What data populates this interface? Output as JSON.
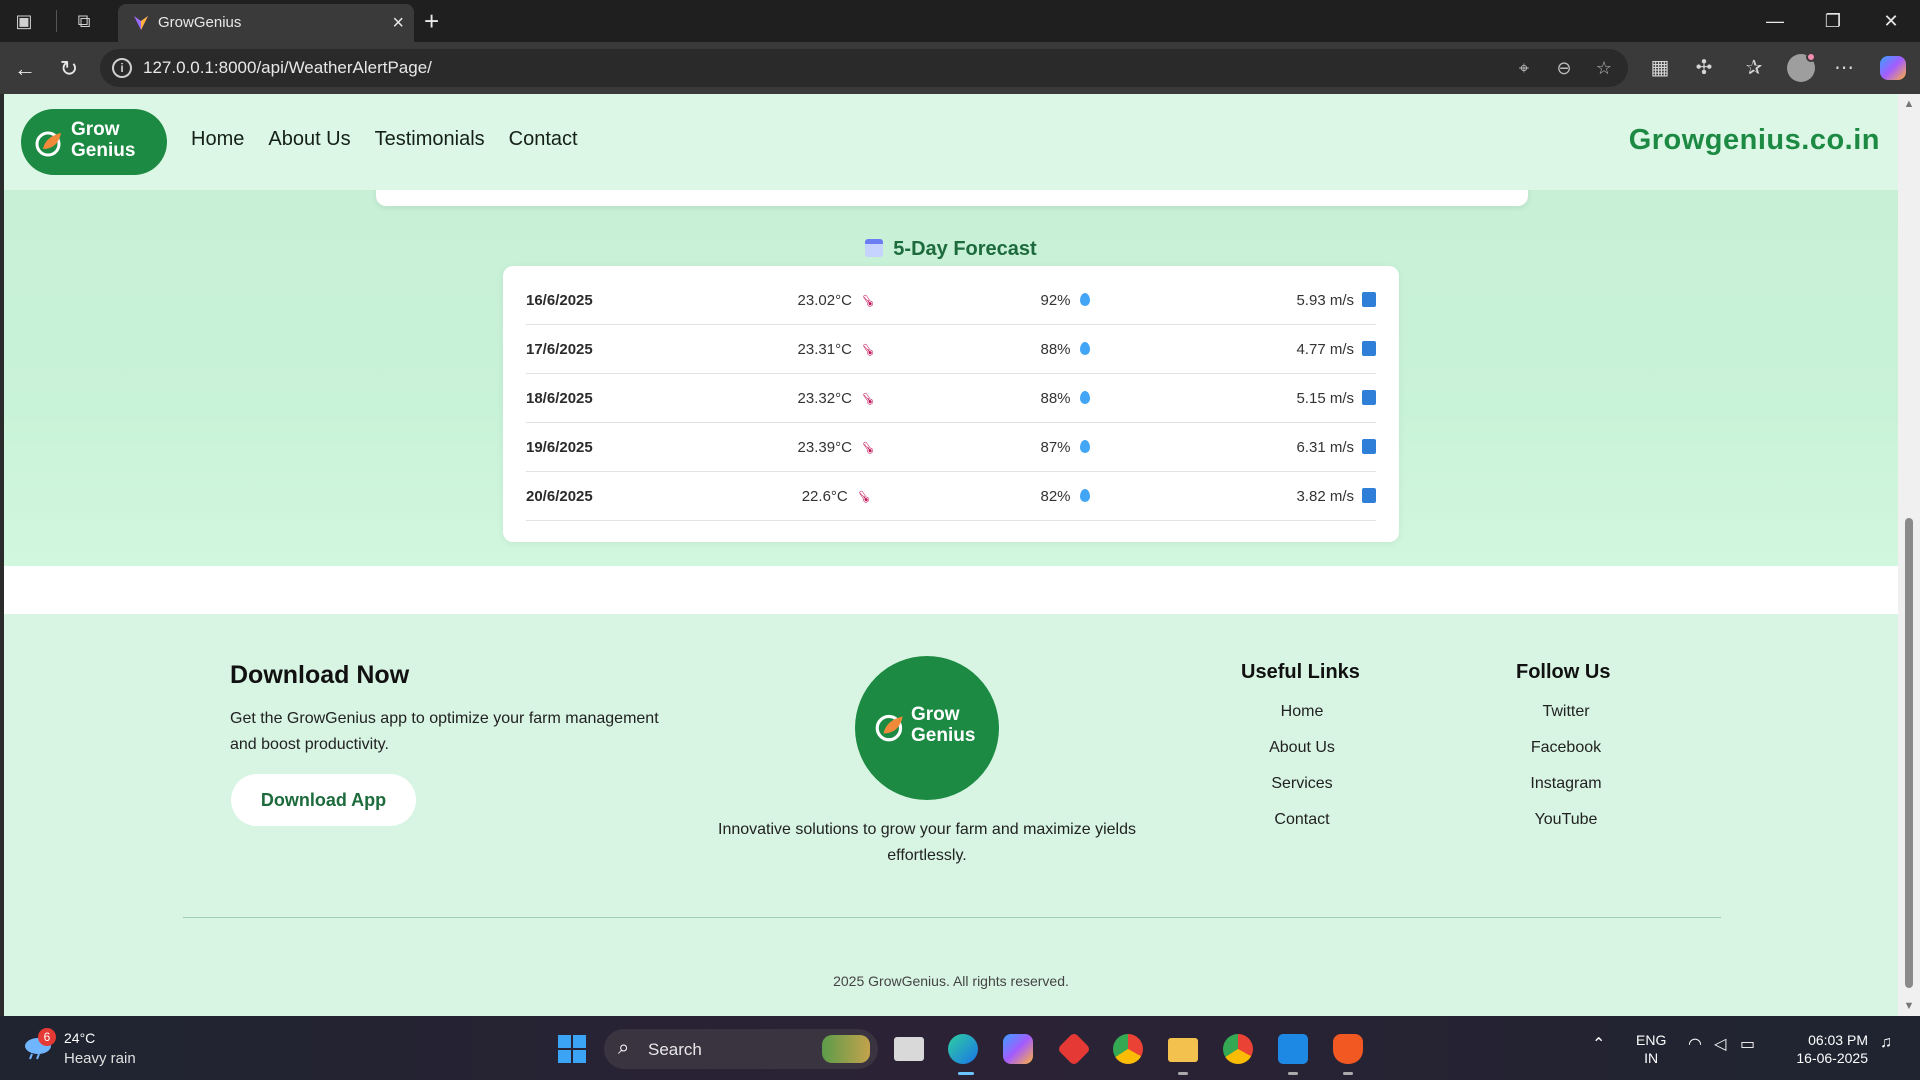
{
  "browser": {
    "tab_title": "GrowGenius",
    "url": "127.0.0.1:8000/api/WeatherAlertPage/"
  },
  "header": {
    "logo_line1": "Grow",
    "logo_line2": "Genius",
    "nav": [
      "Home",
      "About Us",
      "Testimonials",
      "Contact"
    ],
    "brand": "Growgenius.co.in"
  },
  "forecast": {
    "title": "5-Day Forecast",
    "rows": [
      {
        "date": "16/6/2025",
        "temp": "23.02°C",
        "humidity": "92%",
        "wind": "5.93 m/s"
      },
      {
        "date": "17/6/2025",
        "temp": "23.31°C",
        "humidity": "88%",
        "wind": "4.77 m/s"
      },
      {
        "date": "18/6/2025",
        "temp": "23.32°C",
        "humidity": "88%",
        "wind": "5.15 m/s"
      },
      {
        "date": "19/6/2025",
        "temp": "23.39°C",
        "humidity": "87%",
        "wind": "6.31 m/s"
      },
      {
        "date": "20/6/2025",
        "temp": "22.6°C",
        "humidity": "82%",
        "wind": "3.82 m/s"
      }
    ]
  },
  "footer": {
    "download_title": "Download Now",
    "download_text": "Get the GrowGenius app to optimize your farm management and boost productivity.",
    "download_button": "Download App",
    "logo_line1": "Grow",
    "logo_line2": "Genius",
    "tagline": "Innovative solutions to grow your farm and maximize yields effortlessly.",
    "useful_title": "Useful Links",
    "useful_links": [
      "Home",
      "About Us",
      "Services",
      "Contact"
    ],
    "follow_title": "Follow Us",
    "follow_links": [
      "Twitter",
      "Facebook",
      "Instagram",
      "YouTube"
    ],
    "copyright": "2025 GrowGenius. All rights reserved."
  },
  "taskbar": {
    "weather_badge": "6",
    "weather_temp": "24°C",
    "weather_desc": "Heavy rain",
    "search_label": "Search",
    "lang_line1": "ENG",
    "lang_line2": "IN",
    "time": "06:03 PM",
    "date": "16-06-2025"
  },
  "colors": {
    "brand_green": "#1d8a43",
    "page_bg": "#d8f5e4"
  }
}
